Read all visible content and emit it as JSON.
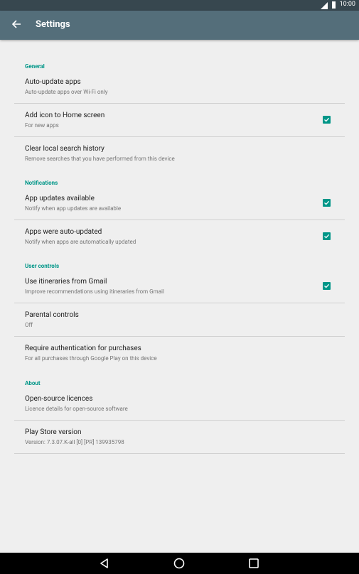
{
  "status_bar": {
    "time": "10:00"
  },
  "app_bar": {
    "title": "Settings"
  },
  "sections": {
    "general": "General",
    "notifications": "Notifications",
    "user_controls": "User controls",
    "about": "About"
  },
  "items": {
    "auto_update": {
      "title": "Auto-update apps",
      "subtitle": "Auto-update apps over Wi-Fi only"
    },
    "add_icon": {
      "title": "Add icon to Home screen",
      "subtitle": "For new apps",
      "checked": true
    },
    "clear_history": {
      "title": "Clear local search history",
      "subtitle": "Remove searches that you have performed from this device"
    },
    "app_updates": {
      "title": "App updates available",
      "subtitle": "Notify when app updates are available",
      "checked": true
    },
    "auto_updated": {
      "title": "Apps were auto-updated",
      "subtitle": "Notify when apps are automatically updated",
      "checked": true
    },
    "itineraries": {
      "title": "Use itineraries from Gmail",
      "subtitle": "Improve recommendations using itineraries from Gmail",
      "checked": true
    },
    "parental": {
      "title": "Parental controls",
      "subtitle": "Off"
    },
    "auth": {
      "title": "Require authentication for purchases",
      "subtitle": "For all purchases through Google Play on this device"
    },
    "licences": {
      "title": "Open-source licences",
      "subtitle": "Licence details for open-source software"
    },
    "version": {
      "title": "Play Store version",
      "subtitle": "Version: 7.3.07.K-all [0] [PR] 139935798"
    }
  },
  "colors": {
    "accent": "#009688",
    "appbar": "#546e7a",
    "statusbar": "#37474f"
  }
}
